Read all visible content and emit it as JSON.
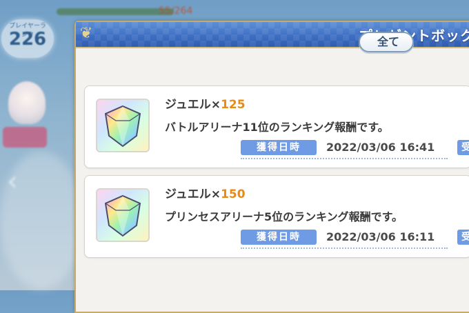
{
  "background": {
    "player_rank_label": "プレイヤーランク",
    "player_rank": "226",
    "stamina_text": "55/264"
  },
  "dialog": {
    "title": "プレゼントボックス",
    "receive_all_label": "全て",
    "colors": {
      "header_blue": "#3f6fc4",
      "gold_border": "#c7ab6a",
      "label_blue": "#6e9be4",
      "quantity_orange": "#e98a12"
    }
  },
  "presents": [
    {
      "item_name": "ジュエル×",
      "quantity": "125",
      "description": "バトルアリーナ11位のランキング報酬です。",
      "date_label": "獲得日時",
      "date_value": "2022/03/06 16:41",
      "receive_label": "受",
      "icon": "jewel-icon"
    },
    {
      "item_name": "ジュエル×",
      "quantity": "150",
      "description": "プリンセスアリーナ5位のランキング報酬です。",
      "date_label": "獲得日時",
      "date_value": "2022/03/06 16:11",
      "receive_label": "受",
      "icon": "jewel-icon"
    }
  ]
}
